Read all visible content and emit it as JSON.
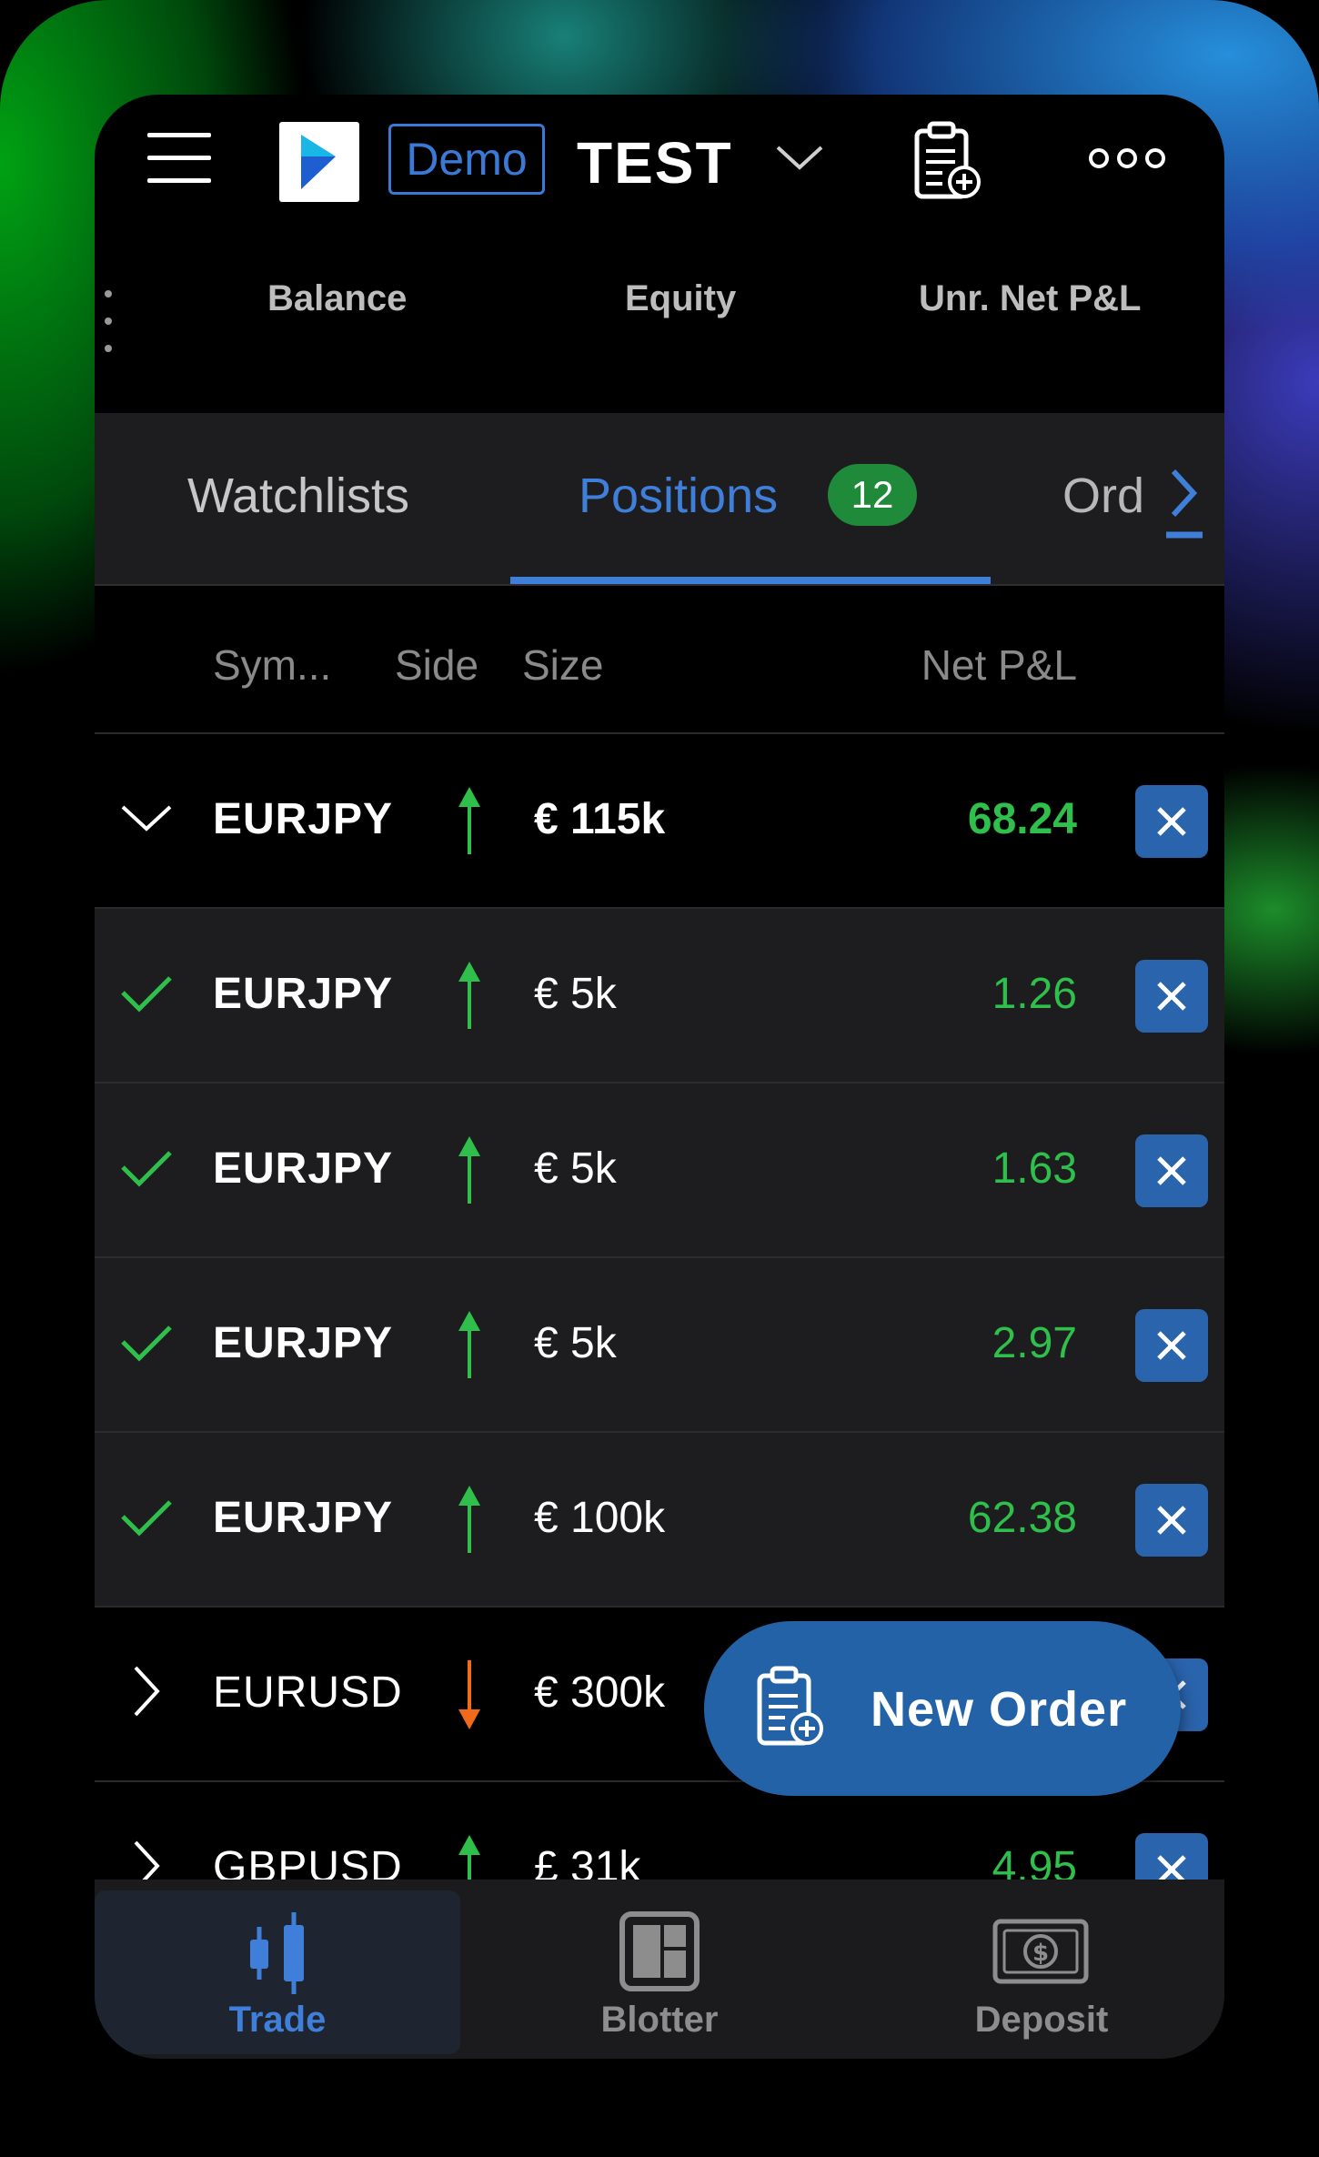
{
  "header": {
    "account_mode": "Demo",
    "account_name": "TEST"
  },
  "summary": {
    "balance_label": "Balance",
    "equity_label": "Equity",
    "unr_pnl_label": "Unr. Net P&L"
  },
  "tabs": [
    {
      "label": "Watchlists"
    },
    {
      "label": "Positions",
      "badge": "12"
    },
    {
      "label": "Ord"
    }
  ],
  "columns": {
    "symbol": "Sym...",
    "side": "Side",
    "size": "Size",
    "net_pnl": "Net P&L"
  },
  "positions": [
    {
      "symbol": "EURJPY",
      "side": "buy",
      "size": "€ 115k",
      "net_pnl": "68.24",
      "state": "expanded"
    },
    {
      "symbol": "EURJPY",
      "side": "buy",
      "size": "€ 5k",
      "net_pnl": "1.26",
      "state": "child"
    },
    {
      "symbol": "EURJPY",
      "side": "buy",
      "size": "€ 5k",
      "net_pnl": "1.63",
      "state": "child"
    },
    {
      "symbol": "EURJPY",
      "side": "buy",
      "size": "€ 5k",
      "net_pnl": "2.97",
      "state": "child"
    },
    {
      "symbol": "EURJPY",
      "side": "buy",
      "size": "€ 100k",
      "net_pnl": "62.38",
      "state": "child"
    },
    {
      "symbol": "EURUSD",
      "side": "sell",
      "size": "€ 300k",
      "net_pnl": "",
      "state": "collapsed"
    },
    {
      "symbol": "GBPUSD",
      "side": "buy",
      "size": "£ 31k",
      "net_pnl": "4.95",
      "state": "collapsed"
    }
  ],
  "fab": {
    "new_order_label": "New Order"
  },
  "bottom_nav": [
    {
      "label": "Trade",
      "active": true
    },
    {
      "label": "Blotter",
      "active": false
    },
    {
      "label": "Deposit",
      "active": false
    }
  ],
  "colors": {
    "accent": "#3f7fd9",
    "profit": "#2ec04b",
    "buy_arrow": "#2ec04b",
    "sell_arrow": "#f06a1a",
    "close_button": "#2a64ad",
    "badge": "#1f8a3a"
  },
  "icons": {
    "menu": "menu-icon",
    "logo": "app-logo",
    "order_ticket": "clipboard-plus-icon",
    "more": "more-dots-icon",
    "trade": "candlestick-icon",
    "blotter": "layout-grid-icon",
    "deposit": "cash-icon"
  }
}
